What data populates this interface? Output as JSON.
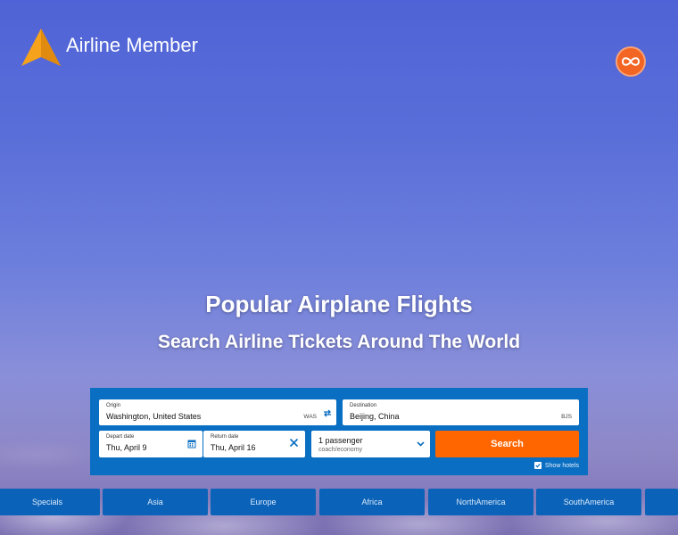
{
  "brand": {
    "name": "Airline Member",
    "accent": "#f7a21b"
  },
  "hero": {
    "title": "Popular Airplane Flights",
    "subtitle": "Search Airline Tickets Around The World"
  },
  "search": {
    "origin": {
      "label": "Origin",
      "value": "Washington, United States",
      "code": "WAS"
    },
    "destination": {
      "label": "Destination",
      "value": "Beijing, China",
      "code": "BJS"
    },
    "depart": {
      "label": "Depart date",
      "value": "Thu, April 9"
    },
    "return": {
      "label": "Return date",
      "value": "Thu, April 16"
    },
    "passengers": {
      "value": "1 passenger",
      "class": "coach/economy"
    },
    "button_label": "Search",
    "show_hotels": "Show hotels",
    "show_hotels_checked": true
  },
  "tabs": [
    {
      "label": "Specials"
    },
    {
      "label": "Asia"
    },
    {
      "label": "Europe"
    },
    {
      "label": "Africa"
    },
    {
      "label": "NorthAmerica"
    },
    {
      "label": "SouthAmerica"
    },
    {
      "label": ""
    }
  ],
  "icons": {
    "logo": "plane-logo-icon",
    "top_right": "infinity-icon",
    "swap": "swap-icon",
    "calendar": "calendar-icon",
    "clear": "close-icon",
    "dropdown": "chevron-down-icon"
  },
  "colors": {
    "panel": "#0a6fc2",
    "search_button": "#ff6600",
    "tab": "#0a63b8",
    "infinity_button": "#f26522"
  }
}
